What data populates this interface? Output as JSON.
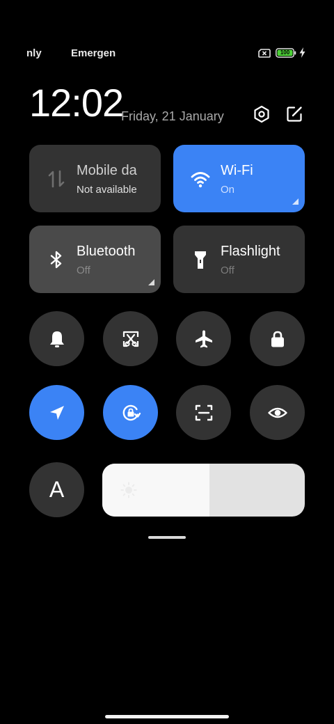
{
  "status_bar": {
    "carrier_1": "nly",
    "carrier_2": "Emergenc",
    "battery_level": "100",
    "battery_color": "#4cd137",
    "icons": [
      "no-sim-icon",
      "battery-icon",
      "charging-bolt-icon"
    ]
  },
  "header": {
    "time": "12:02",
    "date": "Friday, 21 January",
    "icons": [
      "settings-icon",
      "edit-icon"
    ]
  },
  "tiles": [
    {
      "title": "Mobile da",
      "subtitle": "Not available",
      "icon": "mobile-data-icon",
      "active": false
    },
    {
      "title": "Wi-Fi",
      "subtitle": "On",
      "icon": "wifi-icon",
      "active": true
    },
    {
      "title": "Bluetooth",
      "subtitle": "Off",
      "icon": "bluetooth-icon",
      "active": false
    },
    {
      "title": "Flashlight",
      "subtitle": "Off",
      "icon": "flashlight-icon",
      "active": false
    }
  ],
  "toggles_row_1": [
    {
      "icon": "bell-icon",
      "active": false
    },
    {
      "icon": "screenshot-icon",
      "active": false
    },
    {
      "icon": "airplane-icon",
      "active": false
    },
    {
      "icon": "lock-icon",
      "active": false
    }
  ],
  "toggles_row_2": [
    {
      "icon": "location-icon",
      "active": true
    },
    {
      "icon": "rotation-lock-icon",
      "active": true
    },
    {
      "icon": "scanner-icon",
      "active": false
    },
    {
      "icon": "eye-icon",
      "active": false
    }
  ],
  "auto_brightness": {
    "label": "A"
  },
  "brightness": {
    "level_percent": 53,
    "icon": "sun-icon"
  },
  "colors": {
    "accent": "#3b83f5",
    "tile": "#333333",
    "background": "#000000"
  }
}
